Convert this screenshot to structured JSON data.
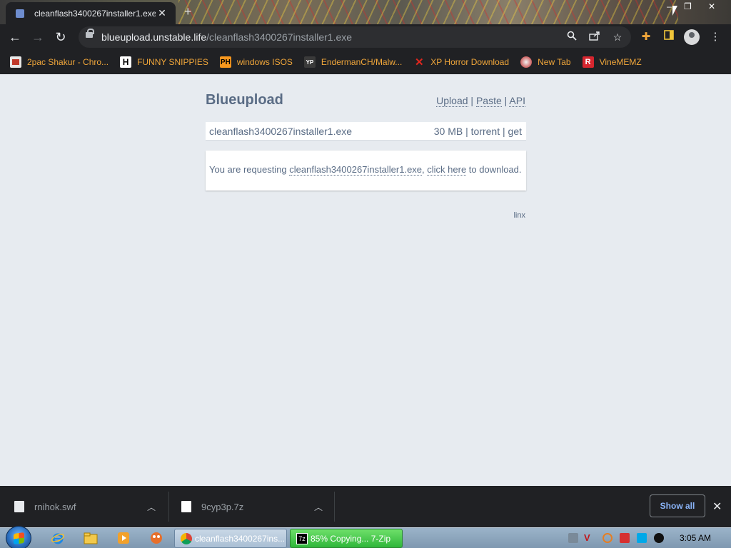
{
  "browser": {
    "tab": {
      "title": "cleanflash3400267installer1.exe",
      "close": "✕"
    },
    "new_tab": "+",
    "window_controls": {
      "minimize": "–",
      "maximize": "❐",
      "close": "✕"
    },
    "url": {
      "host": "blueupload.unstable.life",
      "path": "/cleanflash3400267installer1.exe"
    },
    "bookmarks": [
      {
        "label": "2pac Shakur - Chro...",
        "icon": "folder-icon",
        "color": "#f0a63a"
      },
      {
        "label": "FUNNY SNIPPIES",
        "icon": "h-logo-icon",
        "color": "#ffffff"
      },
      {
        "label": "windows ISOS",
        "icon": "ph-logo-icon",
        "color": "#f7971e"
      },
      {
        "label": "EndermanCH/Malw...",
        "icon": "yp-logo-icon",
        "color": "#3a3a3a"
      },
      {
        "label": "XP Horror Download",
        "icon": "x-logo-icon",
        "color": "#e0271e"
      },
      {
        "label": "New Tab",
        "icon": "globe-icon",
        "color": "#d0d0d0"
      },
      {
        "label": "VineMEMZ",
        "icon": "r-logo-icon",
        "color": "#d6262f"
      }
    ]
  },
  "page": {
    "brand": "Blueupload",
    "top_links": {
      "upload": "Upload",
      "paste": "Paste",
      "api": "API",
      "sep": "|"
    },
    "file": {
      "name": "cleanflash3400267installer1.exe",
      "size": "30 MB",
      "torrent": "torrent",
      "get": "get"
    },
    "message": {
      "prefix": "You are requesting ",
      "filename": "cleanflash3400267installer1.exe",
      "comma": ", ",
      "link": "click here",
      "suffix": " to download."
    },
    "footer": "linx"
  },
  "downloads": {
    "items": [
      {
        "name": "rnihok.swf"
      },
      {
        "name": "9cyp3p.7z"
      }
    ],
    "show_all": "Show all",
    "close": "✕"
  },
  "taskbar": {
    "tasks": [
      {
        "label": "cleanflash3400267ins...",
        "icon": "chrome-icon"
      },
      {
        "label": "85% Copying... 7-Zip",
        "icon": "7zip-icon"
      }
    ],
    "clock": "3:05 AM"
  },
  "colors": {
    "page_bg": "#e7ebf0",
    "text_accent": "#5a6c85",
    "chrome_dark": "#202124",
    "bookmark_text": "#f0a63a",
    "download_link": "#8ab4f8",
    "progress_green": "#3fc34a"
  }
}
